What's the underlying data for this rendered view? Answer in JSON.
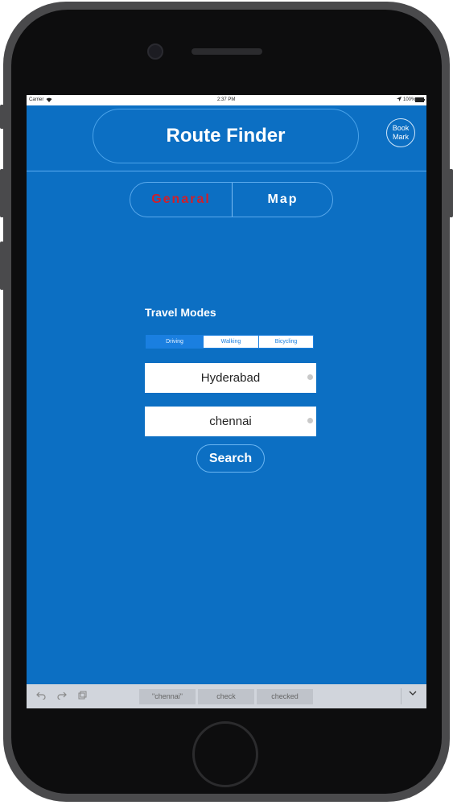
{
  "status": {
    "carrier": "Carrier",
    "wifi_icon": "wifi-icon",
    "time": "2:37 PM",
    "battery": "100%"
  },
  "header": {
    "title": "Route Finder",
    "bookmark_line1": "Book",
    "bookmark_line2": "Mark"
  },
  "tabs": [
    {
      "label": "Genaral",
      "selected": true,
      "color": "#d11f2a"
    },
    {
      "label": "Map",
      "selected": false,
      "color": "#ffffff"
    }
  ],
  "travel": {
    "label": "Travel Modes",
    "modes": [
      {
        "label": "Driving",
        "selected": true
      },
      {
        "label": "Walking",
        "selected": false
      },
      {
        "label": "Bicycling",
        "selected": false
      }
    ]
  },
  "fields": {
    "from": "Hyderabad",
    "to": "chennai"
  },
  "search_label": "Search",
  "keyboard_bar": {
    "suggestions": [
      "\"chennai\"",
      "check",
      "checked"
    ]
  },
  "colors": {
    "background": "#0c6fc3",
    "accent": "#1a7fe0"
  }
}
